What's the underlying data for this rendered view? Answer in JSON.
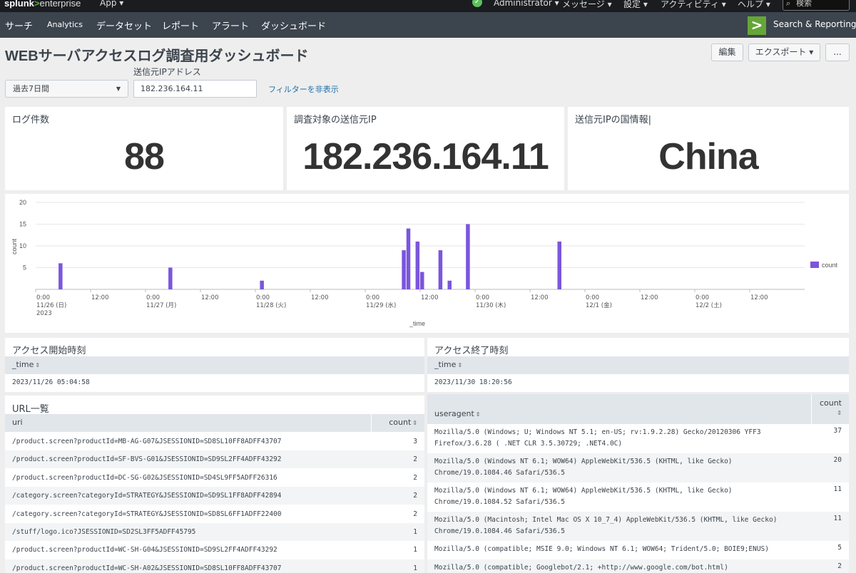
{
  "topbar": {
    "logo_splunk": "splunk",
    "logo_gt": ">",
    "logo_enterprise": "enterprise",
    "app_menu": "App ▾",
    "menus": [
      "Administrator ▾",
      "メッセージ ▾",
      "設定 ▾",
      "アクティビティ ▾",
      "ヘルプ ▾"
    ],
    "search_placeholder": "検索"
  },
  "navbar": {
    "items": [
      "サーチ",
      "Analytics",
      "データセット",
      "レポート",
      "アラート",
      "ダッシュボード"
    ],
    "app_label": "Search & Reporting"
  },
  "dashboard": {
    "title": "WEBサーバアクセスログ調査用ダッシュボード",
    "edit_button": "編集",
    "export_button": "エクスポート ▾",
    "more_button": "..."
  },
  "inputs": {
    "time_label": "",
    "time_value": "過去7日間",
    "ip_label": "送信元IPアドレス",
    "ip_value": "182.236.164.11",
    "hide_filter_link": "フィルターを非表示"
  },
  "singles": [
    {
      "title": "ログ件数",
      "value": "88"
    },
    {
      "title": "調査対象の送信元IP",
      "value": "182.236.164.11"
    },
    {
      "title": "送信元IPの国情報|",
      "value": "China"
    }
  ],
  "chart_data": {
    "type": "bar",
    "title": "",
    "xlabel": "_time",
    "ylabel": "count",
    "ylim": [
      0,
      20
    ],
    "yticks": [
      "20",
      "15",
      "10",
      "5"
    ],
    "legend": {
      "label": "count",
      "placement": "right"
    },
    "grid": true,
    "color": "#7b56db",
    "xticks": [
      {
        "lines": [
          "0:00",
          "11/26 (日)",
          "2023"
        ]
      },
      {
        "lines": [
          "12:00"
        ]
      },
      {
        "lines": [
          "0:00",
          "11/27 (月)"
        ]
      },
      {
        "lines": [
          "12:00"
        ]
      },
      {
        "lines": [
          "0:00",
          "11/28 (火)"
        ]
      },
      {
        "lines": [
          "12:00"
        ]
      },
      {
        "lines": [
          "0:00",
          "11/29 (水)"
        ]
      },
      {
        "lines": [
          "12:00"
        ]
      },
      {
        "lines": [
          "0:00",
          "11/30 (木)"
        ]
      },
      {
        "lines": [
          "12:00"
        ]
      },
      {
        "lines": [
          "0:00",
          "12/1 (金)"
        ]
      },
      {
        "lines": [
          "12:00"
        ]
      },
      {
        "lines": [
          "0:00",
          "12/2 (土)"
        ]
      },
      {
        "lines": [
          "12:00"
        ]
      }
    ],
    "series": [
      {
        "name": "count",
        "x": [
          "2023-11-26 05:00",
          "2023-11-27 05:00",
          "2023-11-28 01:00",
          "2023-11-29 08:00",
          "2023-11-29 09:00",
          "2023-11-29 11:00",
          "2023-11-29 12:00",
          "2023-11-29 16:00",
          "2023-11-29 18:00",
          "2023-11-29 22:00",
          "2023-11-30 18:00"
        ],
        "values": [
          6,
          5,
          2,
          9,
          14,
          11,
          4,
          9,
          2,
          15,
          11
        ]
      }
    ]
  },
  "tables": {
    "access_start": {
      "title": "アクセス開始時刻",
      "header": "_time",
      "value": "2023/11/26 05:04:58"
    },
    "access_end": {
      "title": "アクセス終了時刻",
      "header": "_time",
      "value": "2023/11/30 18:20:56"
    },
    "urls": {
      "title": "URL一覧",
      "headers": [
        "uri",
        "count"
      ],
      "rows": [
        [
          "/product.screen?productId=MB-AG-G07&JSESSIONID=SD8SL10FF8ADFF43707",
          "3"
        ],
        [
          "/product.screen?productId=SF-BVS-G01&JSESSIONID=SD9SL2FF4ADFF43292",
          "2"
        ],
        [
          "/product.screen?productId=DC-SG-G02&JSESSIONID=SD4SL9FF5ADFF26316",
          "2"
        ],
        [
          "/category.screen?categoryId=STRATEGY&JSESSIONID=SD9SL1FF8ADFF42894",
          "2"
        ],
        [
          "/category.screen?categoryId=STRATEGY&JSESSIONID=SD8SL6FF1ADFF22400",
          "2"
        ],
        [
          "/stuff/logo.ico?JSESSIONID=SD2SL3FF5ADFF45795",
          "1"
        ],
        [
          "/product.screen?productId=WC-SH-G04&JSESSIONID=SD9SL2FF4ADFF43292",
          "1"
        ],
        [
          "/product.screen?productId=WC-SH-A02&JSESSIONID=SD8SL10FF8ADFF43707",
          "1"
        ]
      ]
    },
    "useragents": {
      "headers": [
        "useragent",
        "count"
      ],
      "rows": [
        [
          "Mozilla/5.0 (Windows; U; Windows NT 5.1; en-US; rv:1.9.2.28) Gecko/20120306 YFF3 Firefox/3.6.28 ( .NET CLR 3.5.30729; .NET4.0C)",
          "37"
        ],
        [
          "Mozilla/5.0 (Windows NT 6.1; WOW64) AppleWebKit/536.5 (KHTML, like Gecko) Chrome/19.0.1084.46 Safari/536.5",
          "20"
        ],
        [
          "Mozilla/5.0 (Windows NT 6.1; WOW64) AppleWebKit/536.5 (KHTML, like Gecko) Chrome/19.0.1084.52 Safari/536.5",
          "11"
        ],
        [
          "Mozilla/5.0 (Macintosh; Intel Mac OS X 10_7_4) AppleWebKit/536.5 (KHTML, like Gecko) Chrome/19.0.1084.46 Safari/536.5",
          "11"
        ],
        [
          "Mozilla/5.0 (compatible; MSIE 9.0; Windows NT 6.1; WOW64; Trident/5.0; BOIE9;ENUS)",
          "5"
        ],
        [
          "Mozilla/5.0 (compatible; Googlebot/2.1; +http://www.google.com/bot.html)",
          "2"
        ]
      ]
    }
  }
}
